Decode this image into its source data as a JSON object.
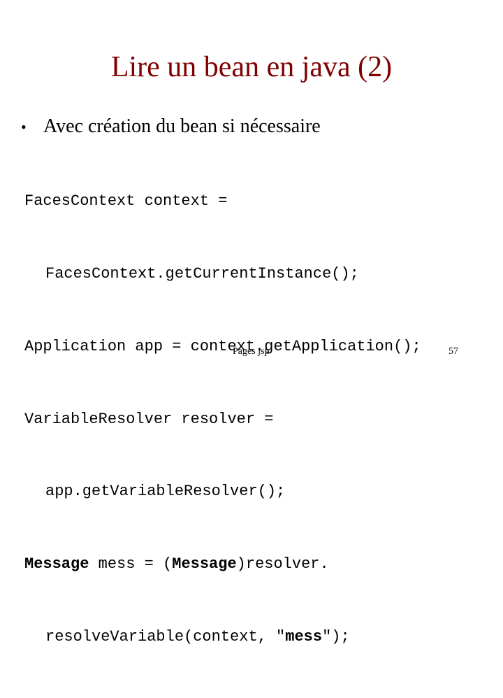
{
  "slide": {
    "title": "Lire un bean en java (2)",
    "title_color": "#800000",
    "bullet": {
      "marker": "•",
      "text": "Avec création du bean si nécessaire"
    },
    "code": {
      "line1": "FacesContext context =",
      "line2": "FacesContext.getCurrentInstance();",
      "line3": "Application app = context.getApplication();",
      "line4": "VariableResolver resolver =",
      "line5": "app.getVariableResolver();",
      "line6": {
        "part1_bold": "Message",
        "part2": " mess = (",
        "part3_bold": "Message",
        "part4": ")resolver."
      },
      "line7": {
        "part1": "resolveVariable(context, \"",
        "part2_bold": "mess",
        "part3": "\");"
      }
    },
    "footer": {
      "center_text": "Pages jsp",
      "page_number": "57"
    }
  }
}
